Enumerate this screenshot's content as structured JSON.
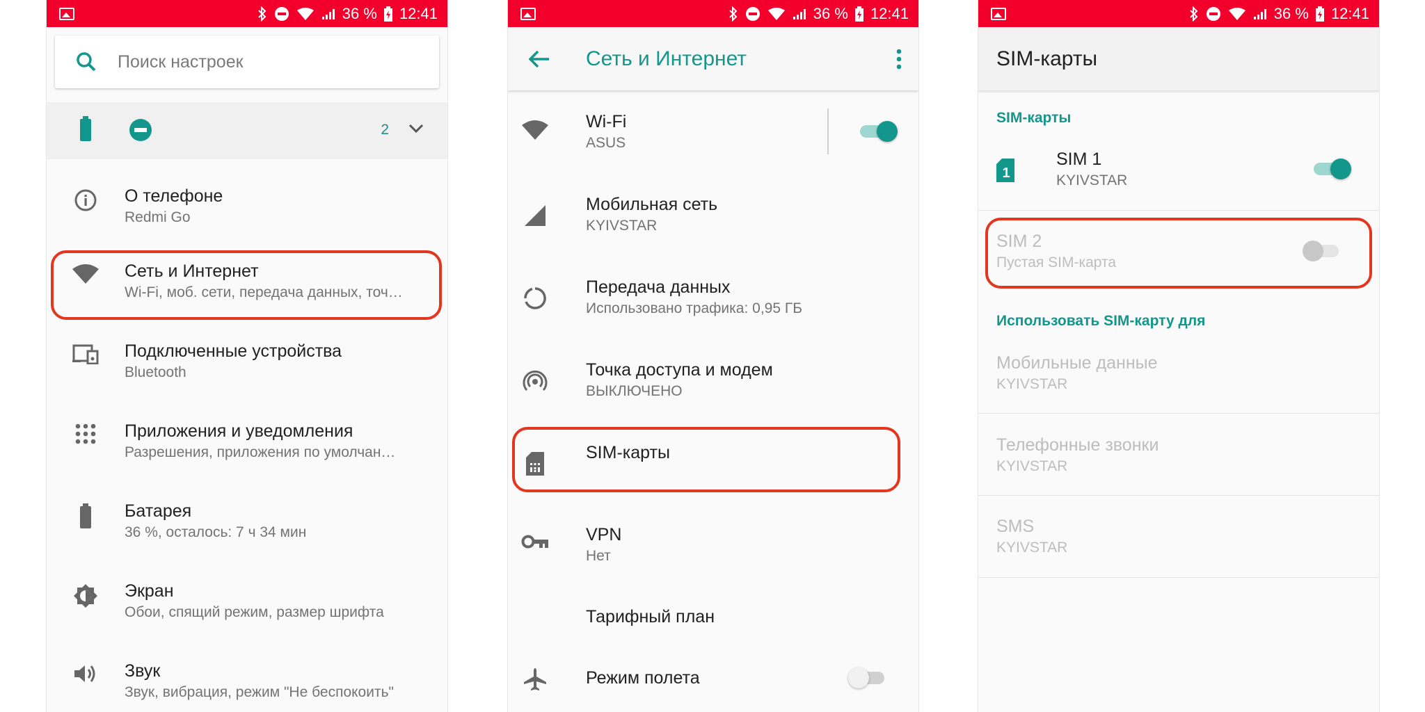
{
  "status": {
    "battery": "36 %",
    "time": "12:41"
  },
  "panel1": {
    "search_placeholder": "Поиск настроек",
    "quick_count": "2",
    "items": [
      {
        "title": "О телефоне",
        "subtitle": "Redmi Go",
        "icon": "info-icon"
      },
      {
        "title": "Сеть и Интернет",
        "subtitle": "Wi-Fi, моб. сети, передача данных, точ…",
        "icon": "wifi-icon"
      },
      {
        "title": "Подключенные устройства",
        "subtitle": "Bluetooth",
        "icon": "devices-icon"
      },
      {
        "title": "Приложения и уведомления",
        "subtitle": "Разрешения, приложения по умолчан…",
        "icon": "apps-grid-icon"
      },
      {
        "title": "Батарея",
        "subtitle": "36 %, осталось: 7 ч 34 мин",
        "icon": "battery-icon"
      },
      {
        "title": "Экран",
        "subtitle": "Обои, спящий режим, размер шрифта",
        "icon": "brightness-icon"
      },
      {
        "title": "Звук",
        "subtitle": "Звук, вибрация, режим \"Не беспокоить\"",
        "icon": "volume-icon"
      }
    ]
  },
  "panel2": {
    "title": "Сеть и Интернет",
    "items": [
      {
        "title": "Wi-Fi",
        "subtitle": "ASUS",
        "icon": "wifi-icon",
        "toggle": true
      },
      {
        "title": "Мобильная сеть",
        "subtitle": "KYIVSTAR",
        "icon": "signal-icon"
      },
      {
        "title": "Передача данных",
        "subtitle": "Использовано трафика: 0,95 ГБ",
        "icon": "data-usage-icon"
      },
      {
        "title": "Точка доступа и модем",
        "subtitle": "ВЫКЛЮЧЕНО",
        "icon": "hotspot-icon"
      },
      {
        "title": "SIM-карты",
        "subtitle": "",
        "icon": "sim-card-icon"
      },
      {
        "title": "VPN",
        "subtitle": "Нет",
        "icon": "vpn-key-icon"
      },
      {
        "title": "Тарифный план",
        "subtitle": "",
        "icon": ""
      },
      {
        "title": "Режим полета",
        "subtitle": "",
        "icon": "airplane-icon",
        "toggle": false
      }
    ]
  },
  "panel3": {
    "title": "SIM-карты",
    "section1": "SIM-карты",
    "sim1": {
      "title": "SIM 1",
      "subtitle": "KYIVSTAR",
      "badge": "1",
      "enabled": true
    },
    "sim2": {
      "title": "SIM 2",
      "subtitle": "Пустая SIM-карта",
      "enabled": false
    },
    "section2": "Использовать SIM-карту для",
    "usage": [
      {
        "title": "Мобильные данные",
        "subtitle": "KYIVSTAR"
      },
      {
        "title": "Телефонные звонки",
        "subtitle": "KYIVSTAR"
      },
      {
        "title": "SMS",
        "subtitle": "KYIVSTAR"
      }
    ]
  },
  "colors": {
    "statusbar": "#f2002b",
    "accent": "#13968c",
    "highlight": "#e2361f"
  }
}
